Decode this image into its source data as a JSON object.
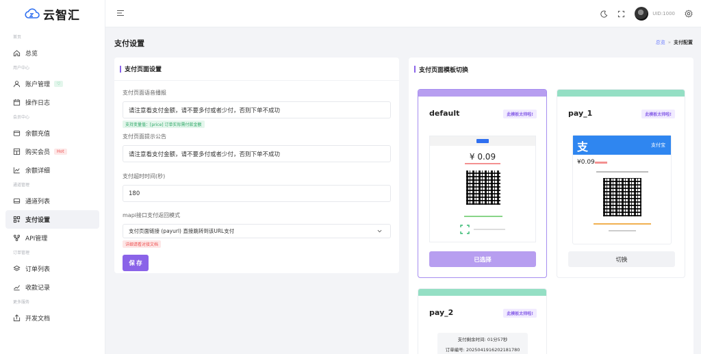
{
  "brand": {
    "name": "云智汇",
    "accent": "#8a63e8",
    "logo_color": "#2f6ff0"
  },
  "sidebar": {
    "groups": [
      {
        "label": "首页",
        "items": [
          {
            "label": "总览",
            "icon": "home-icon"
          }
        ]
      },
      {
        "label": "用户中心",
        "items": [
          {
            "label": "账户管理",
            "icon": "user-icon",
            "badge": "♡"
          },
          {
            "label": "操作日志",
            "icon": "calendar-icon"
          }
        ]
      },
      {
        "label": "会员中心",
        "items": [
          {
            "label": "余额充值",
            "icon": "wallet-icon"
          },
          {
            "label": "购买会员",
            "icon": "grid-icon",
            "badge": "Hot"
          },
          {
            "label": "余额详细",
            "icon": "chart-icon"
          }
        ]
      },
      {
        "label": "通道管理",
        "items": [
          {
            "label": "通道列表",
            "icon": "drive-icon"
          },
          {
            "label": "支付设置",
            "icon": "apps-icon",
            "active": true
          },
          {
            "label": "API管理",
            "icon": "api-icon"
          }
        ]
      },
      {
        "label": "订单管理",
        "items": [
          {
            "label": "订单列表",
            "icon": "layers-icon"
          },
          {
            "label": "收款记录",
            "icon": "record-icon"
          }
        ]
      },
      {
        "label": "更多服务",
        "items": [
          {
            "label": "开发文档",
            "icon": "doc-icon"
          }
        ]
      }
    ]
  },
  "topbar": {
    "uid": "UID:1000"
  },
  "page": {
    "title": "支付设置",
    "breadcrumb": {
      "home": "总览",
      "sep": "»",
      "current": "支付配置"
    }
  },
  "settings_card": {
    "title": "支付页面设置",
    "voice_label": "支付页面语音播报",
    "voice_value": "请注意看支付金额，请不要多付或者少付，否则下单不成功",
    "voice_tip": "支持变量值：[price] 订单实际需付款金额",
    "notice_label": "支付页面提示公告",
    "notice_value": "请注意看支付金额，请不要多付或者少付，否则下单不成功",
    "timeout_label": "支付超时时间(秒)",
    "timeout_value": "180",
    "mapi_label": "mapi接口支付返回模式",
    "mapi_value": "支付页面链接 (payurl) 直接跳转到该URL支付",
    "mapi_tip": "详细请看对接文档",
    "save_label": "保 存"
  },
  "template_card": {
    "title": "支付页面模板切换",
    "templates": [
      {
        "name": "default",
        "badge": "此模板太帅啦!",
        "button": "已选择",
        "selected": true,
        "top_color": "#b79ef0",
        "amount": "¥ 0.09"
      },
      {
        "name": "pay_1",
        "badge": "此模板太帅啦!",
        "button": "切换",
        "selected": false,
        "top_color": "#94dfc4",
        "amount": "¥0.09",
        "header": "支付宝"
      },
      {
        "name": "pay_2",
        "badge": "此模板太帅啦!",
        "button": "切换",
        "selected": false,
        "top_color": "#94dfc4",
        "line1": "支付剩余时间: 01分57秒",
        "line2": "订单编号: 2025041916202181780"
      }
    ]
  }
}
